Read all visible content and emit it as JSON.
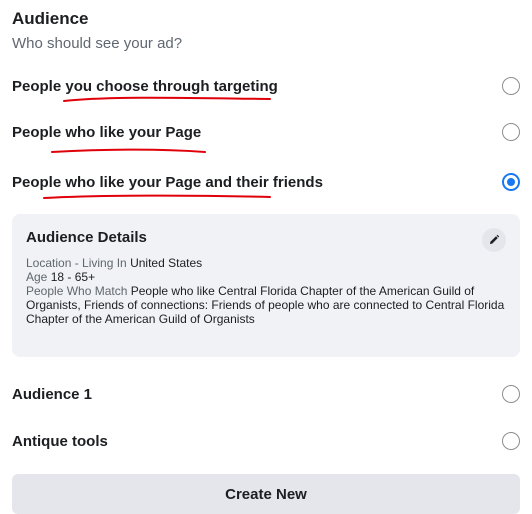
{
  "audience": {
    "title": "Audience",
    "subtitle": "Who should see your ad?",
    "options": [
      {
        "label": "People you choose through targeting",
        "selected": false
      },
      {
        "label": "People who like your Page",
        "selected": false
      },
      {
        "label": "People who like your Page and their friends",
        "selected": true
      }
    ]
  },
  "details": {
    "title": "Audience Details",
    "edit_icon": "pencil-icon",
    "location_label": "Location - Living In",
    "location_value": "United States",
    "age_label": "Age",
    "age_value": "18 - 65+",
    "match_label": "People Who Match",
    "match_value": "People who like Central Florida Chapter of the American Guild of Organists, Friends of connections: Friends of people who are connected to Central Florida Chapter of the American Guild of Organists"
  },
  "saved_audiences": [
    {
      "label": "Audience 1",
      "selected": false
    },
    {
      "label": "Antique tools",
      "selected": false
    }
  ],
  "create_new_label": "Create New",
  "colors": {
    "accent": "#1877f2",
    "annotation_red": "#e0000a",
    "card_background": "#f0f2f5",
    "button_background": "#e4e6eb"
  }
}
